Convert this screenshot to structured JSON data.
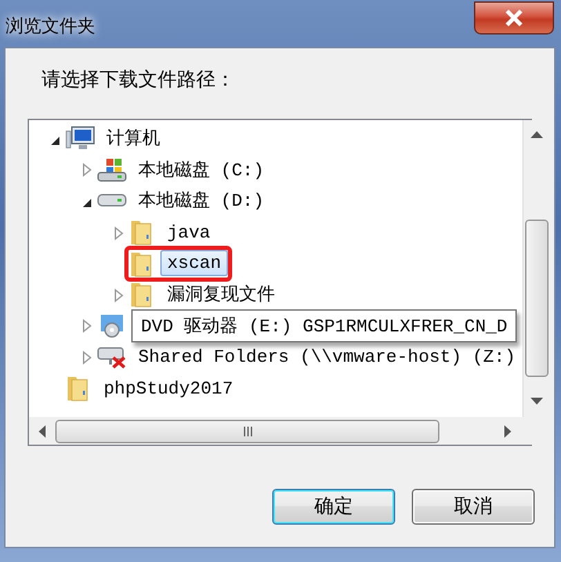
{
  "window": {
    "title": "浏览文件夹"
  },
  "prompt": "请选择下载文件路径：",
  "tree": [
    {
      "label": "计算机",
      "kind": "computer",
      "expanded": true,
      "selected": false,
      "children": [
        {
          "label": "本地磁盘 (C:)",
          "kind": "system-drive",
          "expanded": false,
          "selected": false
        },
        {
          "label": "本地磁盘 (D:)",
          "kind": "drive",
          "expanded": true,
          "selected": false,
          "children": [
            {
              "label": "java",
              "kind": "folder",
              "expanded": false,
              "selected": false
            },
            {
              "label": "xscan",
              "kind": "folder",
              "selected": true,
              "highlighted": true
            },
            {
              "label": "漏洞复现文件",
              "kind": "folder",
              "expanded": false,
              "selected": false
            }
          ]
        },
        {
          "label": "DVD 驱动器 (E:) GSP1RMCULXFRER_CN_D",
          "kind": "dvd",
          "expanded": false,
          "selected": false,
          "tooltip": true
        },
        {
          "label": "Shared Folders (\\\\vmware-host) (Z:)",
          "kind": "network-drive",
          "expanded": false,
          "selected": false
        }
      ]
    },
    {
      "label": "phpStudy2017",
      "kind": "folder",
      "selected": false
    }
  ],
  "buttons": [
    {
      "label": "确定",
      "default": true
    },
    {
      "label": "取消",
      "default": false
    }
  ]
}
